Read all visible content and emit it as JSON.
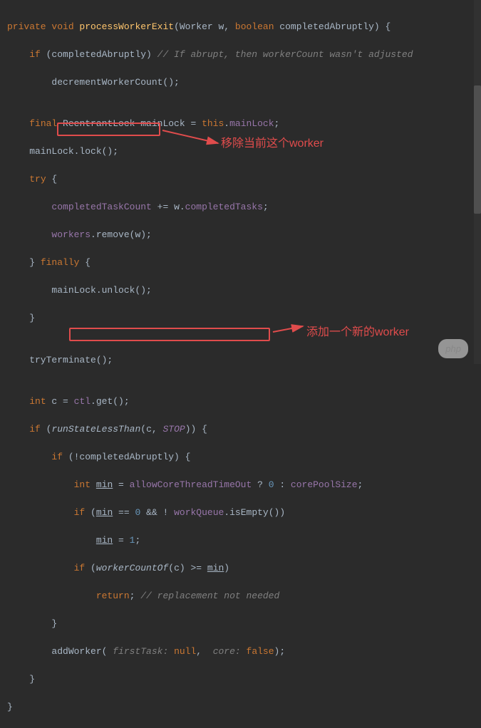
{
  "code": {
    "l1_kw1": "private void",
    "l1_method": " processWorkerExit",
    "l1_p1": "(Worker w, ",
    "l1_kw2": "boolean",
    "l1_p2": " completedAbruptly) {",
    "l2_a": "    ",
    "l2_kw": "if",
    "l2_b": " (completedAbruptly) ",
    "l2_comment": "// If abrupt, then workerCount wasn't adjusted",
    "l3": "        decrementWorkerCount();",
    "l4": "",
    "l5_a": "    ",
    "l5_kw": "final",
    "l5_b": " ReentrantLock mainLock = ",
    "l5_kw2": "this",
    "l5_c": ".",
    "l5_field": "mainLock",
    "l5_d": ";",
    "l6": "    mainLock.lock();",
    "l7_a": "    ",
    "l7_kw": "try",
    "l7_b": " {",
    "l8_a": "        ",
    "l8_field1": "completedTaskCount",
    "l8_b": " += w.",
    "l8_field2": "completedTasks",
    "l8_c": ";",
    "l9_a": "        ",
    "l9_field": "workers",
    "l9_b": ".remove(w);",
    "l10_a": "    } ",
    "l10_kw": "finally",
    "l10_b": " {",
    "l11": "        mainLock.unlock();",
    "l12": "    }",
    "l13": "",
    "l14": "    tryTerminate();",
    "l15": "",
    "l16_a": "    ",
    "l16_kw": "int",
    "l16_b": " c = ",
    "l16_field": "ctl",
    "l16_c": ".get();",
    "l17_a": "    ",
    "l17_kw": "if",
    "l17_b": " (",
    "l17_method": "runStateLessThan",
    "l17_c": "(c, ",
    "l17_const": "STOP",
    "l17_d": ")) {",
    "l18_a": "        ",
    "l18_kw": "if",
    "l18_b": " (!completedAbruptly) {",
    "l19_a": "            ",
    "l19_kw": "int",
    "l19_b": " ",
    "l19_var": "min",
    "l19_c": " = ",
    "l19_field1": "allowCoreThreadTimeOut",
    "l19_d": " ? ",
    "l19_num": "0",
    "l19_e": " : ",
    "l19_field2": "corePoolSize",
    "l19_f": ";",
    "l20_a": "            ",
    "l20_kw": "if",
    "l20_b": " (",
    "l20_var": "min",
    "l20_c": " == ",
    "l20_num": "0",
    "l20_d": " && ! ",
    "l20_field": "workQueue",
    "l20_e": ".isEmpty())",
    "l21_a": "                ",
    "l21_var": "min",
    "l21_b": " = ",
    "l21_num": "1",
    "l21_c": ";",
    "l22_a": "            ",
    "l22_kw": "if",
    "l22_b": " (",
    "l22_method": "workerCountOf",
    "l22_c": "(c) >= ",
    "l22_var": "min",
    "l22_d": ")",
    "l23_a": "                ",
    "l23_kw": "return",
    "l23_b": "; ",
    "l23_comment": "// replacement not needed",
    "l24": "        }",
    "l25_a": "        addWorker( ",
    "l25_label1": "firstTask:",
    "l25_b": " ",
    "l25_kw1": "null",
    "l25_c": ",  ",
    "l25_label2": "core:",
    "l25_d": " ",
    "l25_kw2": "false",
    "l25_e": ");",
    "l26": "    }",
    "l27": "}"
  },
  "annotations": {
    "remove_worker": "移除当前这个worker",
    "add_worker": "添加一个新的worker"
  },
  "watermark": "php"
}
